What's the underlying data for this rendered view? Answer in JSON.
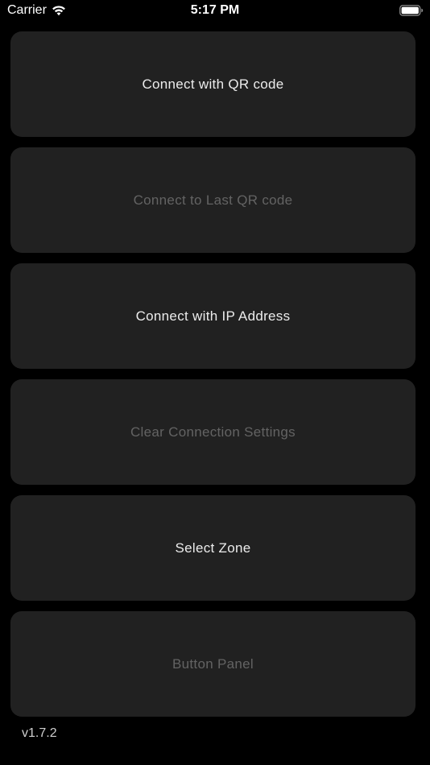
{
  "status_bar": {
    "carrier": "Carrier",
    "time": "5:17 PM",
    "wifi_icon": "wifi-icon",
    "battery_icon": "battery-icon"
  },
  "menu": {
    "buttons": [
      {
        "label": "Connect with QR code",
        "enabled": true
      },
      {
        "label": "Connect to Last QR code",
        "enabled": false
      },
      {
        "label": "Connect with IP Address",
        "enabled": true
      },
      {
        "label": "Clear Connection Settings",
        "enabled": false
      },
      {
        "label": "Select Zone",
        "enabled": true
      },
      {
        "label": "Button Panel",
        "enabled": false
      }
    ]
  },
  "footer": {
    "version": "v1.7.2"
  },
  "colors": {
    "background": "#000000",
    "button_background": "#212121",
    "enabled_text": "#ececec",
    "disabled_text": "#636363"
  }
}
